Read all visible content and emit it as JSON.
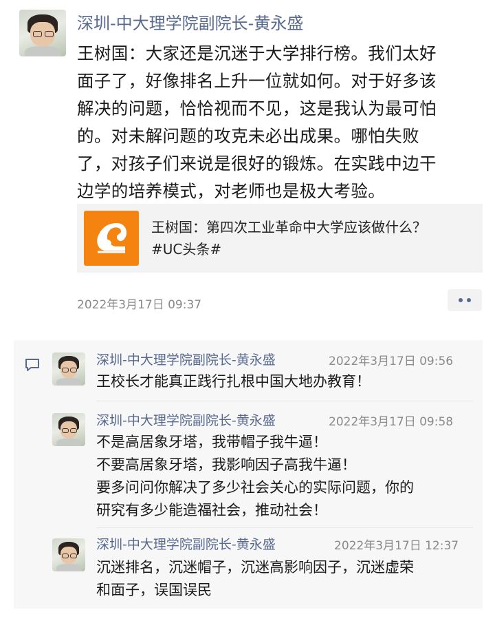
{
  "post": {
    "author": "深圳-中大理学院副院长-黄永盛",
    "text": "王树国：大家还是沉迷于大学排行榜。我们太好\n面子了，好像排名上升一位就如何。对于好多该\n解决的问题，恰恰视而不见，这是我认为最可怕\n的。对未解问题的攻克未必出成果。哪怕失败\n了，对孩子们来说是很好的锻炼。在实践中边干\n边学的培养模式，对老师也是极大考验。",
    "link": {
      "title": "王树国：第四次工业革命中大学应该做什么？\n#UC头条#",
      "icon": "uc-squirrel-logo"
    },
    "time": "2022年3月17日 09:37"
  },
  "comments": [
    {
      "author": "深圳-中大理学院副院长-黄永盛",
      "time": "2022年3月17日 09:56",
      "text": "王校长才能真正践行扎根中国大地办教育！"
    },
    {
      "author": "深圳-中大理学院副院长-黄永盛",
      "time": "2022年3月17日 09:58",
      "text": "不是高居象牙塔，我带帽子我牛逼！\n不要高居象牙塔，我影响因子高我牛逼！\n要多问问你解决了多少社会关心的实际问题，你的\n研究有多少能造福社会，推动社会！"
    },
    {
      "author": "深圳-中大理学院副院长-黄永盛",
      "time": "2022年3月17日 12:37",
      "text": "沉迷排名，沉迷帽子，沉迷高影响因子，沉迷虚荣\n和面子，误国误民"
    }
  ],
  "colors": {
    "name_link": "#57698f",
    "uc_orange": "#f5830f",
    "comment_bg": "#f7f7f7"
  }
}
